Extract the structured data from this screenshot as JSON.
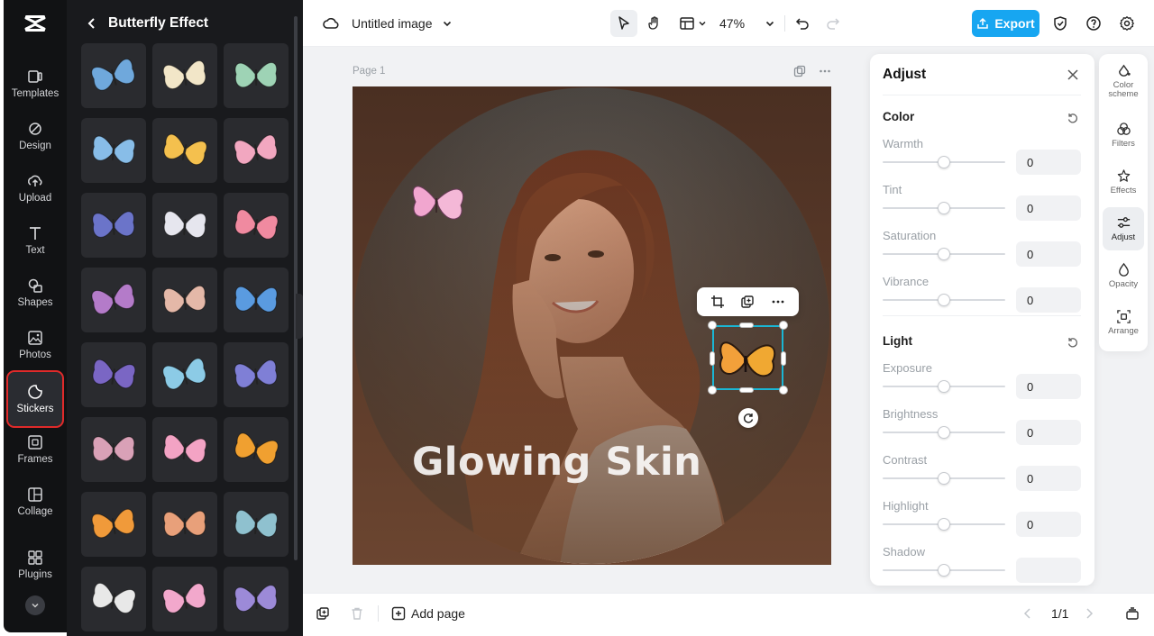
{
  "rail": {
    "items": [
      {
        "label": "Templates",
        "icon": "templates-icon"
      },
      {
        "label": "Design",
        "icon": "design-icon"
      },
      {
        "label": "Upload",
        "icon": "upload-icon"
      },
      {
        "label": "Text",
        "icon": "text-icon"
      },
      {
        "label": "Shapes",
        "icon": "shapes-icon"
      },
      {
        "label": "Photos",
        "icon": "photos-icon"
      },
      {
        "label": "Stickers",
        "icon": "stickers-icon",
        "active": true
      },
      {
        "label": "Frames",
        "icon": "frames-icon"
      },
      {
        "label": "Collage",
        "icon": "collage-icon"
      },
      {
        "label": "Plugins",
        "icon": "plugins-icon"
      }
    ]
  },
  "panel": {
    "title": "Butterfly Effect",
    "stickers": [
      "#6fa8dc",
      "#f2e6c8",
      "#9ed3b5",
      "#88bde8",
      "#f4c04e",
      "#f2a7c0",
      "#6b74c9",
      "#e6e6ee",
      "#f08aa0",
      "#b47bc9",
      "#e4b8a8",
      "#5a9be0",
      "#7a66c4",
      "#8ccbe6",
      "#7f7fd6",
      "#d9a1b7",
      "#f3a3c4",
      "#f0a030",
      "#f09a3a",
      "#e8a07a",
      "#8fc1cf",
      "#e8e8e8",
      "#f2a8cc",
      "#9c8ad8"
    ]
  },
  "topbar": {
    "title": "Untitled image",
    "zoom": "47%",
    "export_label": "Export"
  },
  "canvas": {
    "page_label": "Page 1",
    "headline": "Glowing Skin"
  },
  "adjust": {
    "title": "Adjust",
    "sections": [
      {
        "title": "Color",
        "rows": [
          {
            "label": "Warmth",
            "value": "0"
          },
          {
            "label": "Tint",
            "value": "0"
          },
          {
            "label": "Saturation",
            "value": "0"
          },
          {
            "label": "Vibrance",
            "value": "0"
          }
        ]
      },
      {
        "title": "Light",
        "rows": [
          {
            "label": "Exposure",
            "value": "0"
          },
          {
            "label": "Brightness",
            "value": "0"
          },
          {
            "label": "Contrast",
            "value": "0"
          },
          {
            "label": "Highlight",
            "value": "0"
          },
          {
            "label": "Shadow",
            "value": ""
          }
        ]
      }
    ]
  },
  "right_tools": [
    {
      "label": "Color scheme",
      "icon": "color-scheme-icon"
    },
    {
      "label": "Filters",
      "icon": "filters-icon"
    },
    {
      "label": "Effects",
      "icon": "effects-icon"
    },
    {
      "label": "Adjust",
      "icon": "adjust-icon",
      "active": true
    },
    {
      "label": "Opacity",
      "icon": "opacity-icon"
    },
    {
      "label": "Arrange",
      "icon": "arrange-icon"
    }
  ],
  "bottombar": {
    "add_page": "Add page",
    "page_counter": "1/1"
  },
  "colors": {
    "accent": "#17a6f1",
    "rail_bg": "#111214",
    "panel_bg": "#191a1d",
    "selection": "#1ab6d4",
    "highlight_outline": "#e02a2a"
  }
}
